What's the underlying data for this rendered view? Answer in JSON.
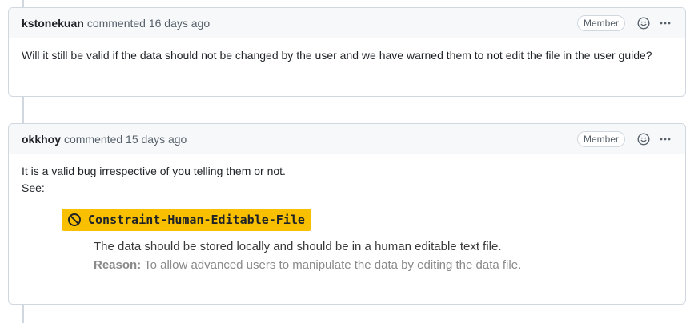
{
  "comments": [
    {
      "author": "kstonekuan",
      "meta": "commented 16 days ago",
      "role": "Member",
      "body": "Will it still be valid if the data should not be changed by the user and we have warned them to not edit the file in the user guide?"
    },
    {
      "author": "okkhoy",
      "meta": "commented 15 days ago",
      "role": "Member",
      "body_line1": "It is a valid bug irrespective of you telling them or not.",
      "body_line2": "See:",
      "constraint": {
        "name": "Constraint-Human-Editable-File",
        "icon": "ban-icon",
        "description": "The data should be stored locally and should be in a human editable text file.",
        "reason_label": "Reason:",
        "reason_text": "To allow advanced users to manipulate the data by editing the data file.",
        "tag_color": "#f8c000"
      }
    }
  ],
  "icons": {
    "emoji": "smiley-icon",
    "more": "kebab-horizontal-icon"
  }
}
